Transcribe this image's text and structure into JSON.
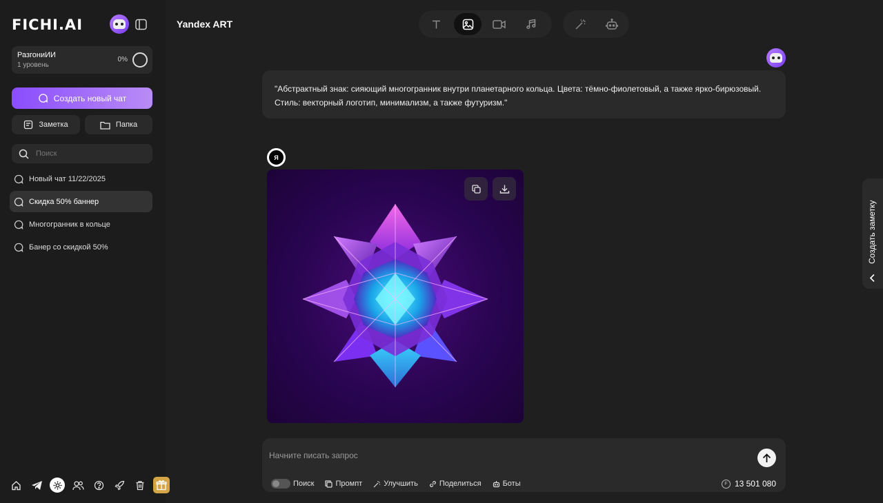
{
  "sidebar": {
    "logo": "FICHI.AI",
    "level": {
      "name": "РазгониИИ",
      "sub": "1 уровень",
      "percent": "0%"
    },
    "new_chat_label": "Создать новый чат",
    "note_label": "Заметка",
    "folder_label": "Папка",
    "search_placeholder": "Поиск",
    "chats": [
      {
        "label": "Новый чат 11/22/2025",
        "active": false
      },
      {
        "label": "Скидка 50% баннер",
        "active": true
      },
      {
        "label": "Многогранник в кольце",
        "active": false
      },
      {
        "label": "Банер со скидкой 50%",
        "active": false
      }
    ],
    "bottom_icons": [
      "home-icon",
      "telegram-icon",
      "settings-icon",
      "users-icon",
      "help-icon",
      "rocket-icon",
      "trash-icon",
      "gift-icon"
    ]
  },
  "header": {
    "model_title": "Yandex ART",
    "modes": [
      "text-icon",
      "image-icon",
      "video-icon",
      "music-icon"
    ],
    "active_mode": "image-icon",
    "extras": [
      "magic-wand-icon",
      "bot-icon"
    ]
  },
  "chat": {
    "prompt": "\"Абстрактный знак: сияющий многогранник внутри планетарного кольца. Цвета: тёмно-фиолетовый, а также ярко-бирюзовый. Стиль: векторный логотип, минимализм, а также футуризм.\"",
    "model_badge": "Я"
  },
  "composer": {
    "placeholder": "Начните писать запрос",
    "tools": {
      "search": "Поиск",
      "prompt": "Промпт",
      "improve": "Улучшить",
      "share": "Поделиться",
      "bots": "Боты"
    },
    "balance": "13 501 080"
  },
  "note_tab": {
    "label": "Создать заметку"
  },
  "colors": {
    "accent_start": "#8a4dff",
    "accent_end": "#b98cf5",
    "background": "#1f1f1f",
    "panel": "#2a2a2a"
  }
}
